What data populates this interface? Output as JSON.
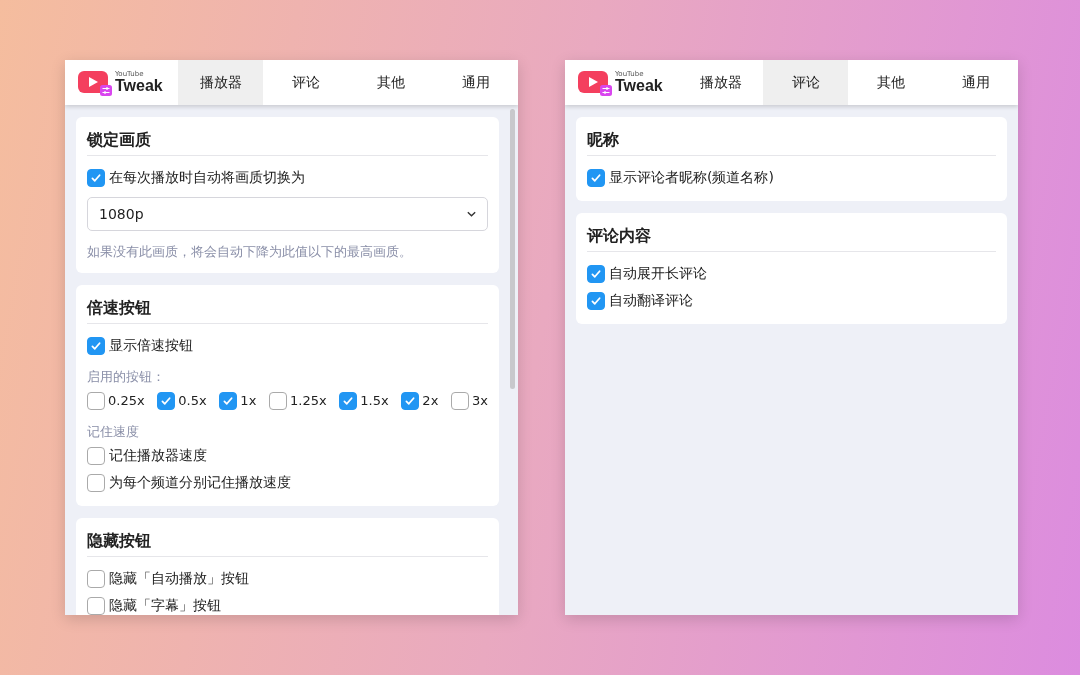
{
  "panels": [
    {
      "logo": {
        "small": "YouTube",
        "big": "Tweak"
      },
      "scrollbar": true,
      "tabs": [
        {
          "label": "播放器",
          "selected": true
        },
        {
          "label": "评论",
          "selected": false
        },
        {
          "label": "其他",
          "selected": false
        },
        {
          "label": "通用",
          "selected": false
        }
      ],
      "sections": [
        {
          "title": "锁定画质",
          "items": [
            {
              "kind": "checkbox",
              "label": "在每次播放时自动将画质切换为",
              "checked": true
            },
            {
              "kind": "select",
              "value": "1080p"
            },
            {
              "kind": "hint",
              "text": "如果没有此画质，将会自动下降为此值以下的最高画质。"
            }
          ]
        },
        {
          "title": "倍速按钮",
          "items": [
            {
              "kind": "checkbox",
              "label": "显示倍速按钮",
              "checked": true
            },
            {
              "kind": "label",
              "text": "启用的按钮："
            },
            {
              "kind": "checkbox-row",
              "options": [
                {
                  "label": "0.25x",
                  "checked": false
                },
                {
                  "label": "0.5x",
                  "checked": true
                },
                {
                  "label": "1x",
                  "checked": true
                },
                {
                  "label": "1.25x",
                  "checked": false
                },
                {
                  "label": "1.5x",
                  "checked": true
                },
                {
                  "label": "2x",
                  "checked": true
                },
                {
                  "label": "3x",
                  "checked": false
                }
              ]
            },
            {
              "kind": "label",
              "text": "记住速度"
            },
            {
              "kind": "checkbox",
              "label": "记住播放器速度",
              "checked": false
            },
            {
              "kind": "checkbox",
              "label": "为每个频道分别记住播放速度",
              "checked": false
            }
          ]
        },
        {
          "title": "隐藏按钮",
          "items": [
            {
              "kind": "checkbox",
              "label": "隐藏「自动播放」按钮",
              "checked": false
            },
            {
              "kind": "checkbox",
              "label": "隐藏「字幕」按钮",
              "checked": false
            }
          ]
        }
      ]
    },
    {
      "logo": {
        "small": "YouTube",
        "big": "Tweak"
      },
      "tabs": [
        {
          "label": "播放器",
          "selected": false
        },
        {
          "label": "评论",
          "selected": true
        },
        {
          "label": "其他",
          "selected": false
        },
        {
          "label": "通用",
          "selected": false
        }
      ],
      "sections": [
        {
          "title": "昵称",
          "items": [
            {
              "kind": "checkbox",
              "label": "显示评论者昵称(频道名称)",
              "checked": true
            }
          ]
        },
        {
          "title": "评论内容",
          "items": [
            {
              "kind": "checkbox",
              "label": "自动展开长评论",
              "checked": true
            },
            {
              "kind": "checkbox",
              "label": "自动翻译评论",
              "checked": true
            }
          ]
        }
      ]
    }
  ]
}
